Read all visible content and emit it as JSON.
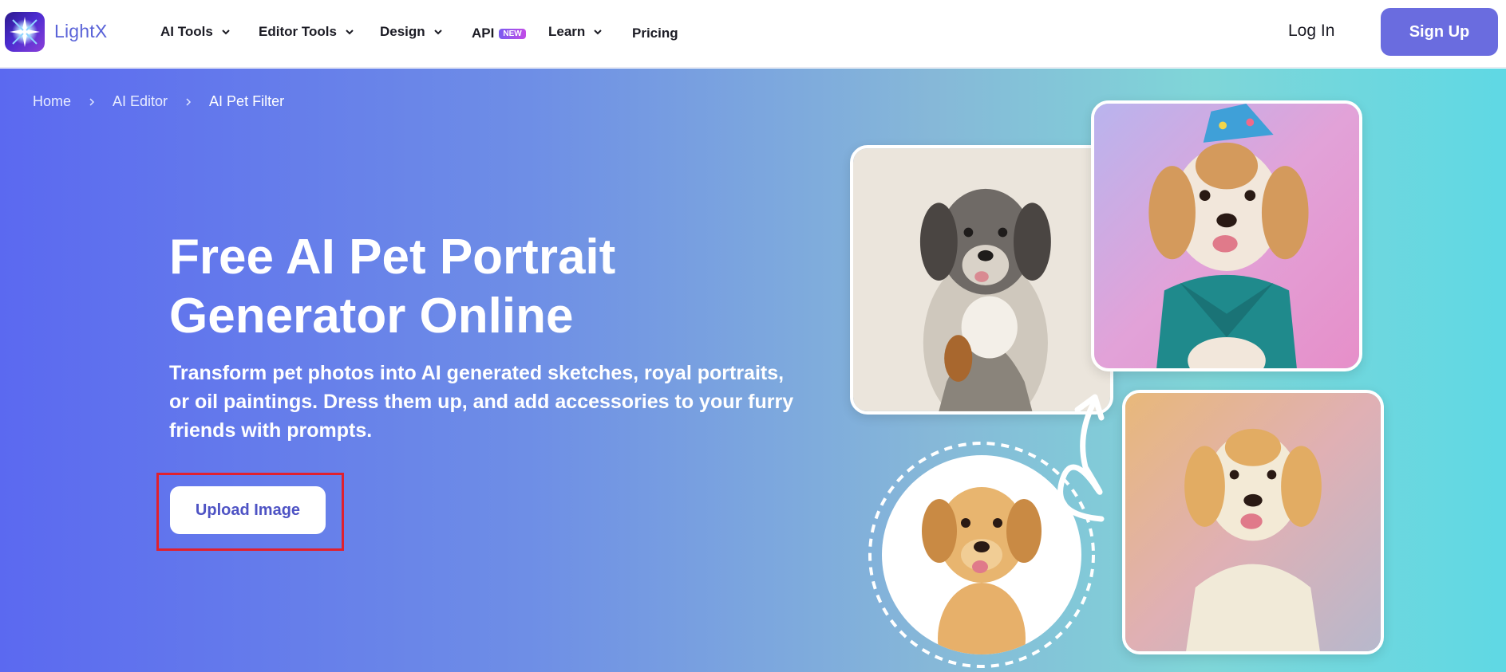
{
  "brand": {
    "name": "LightX",
    "logo_icon": "lightx-star-icon"
  },
  "nav": {
    "items": [
      {
        "label": "AI Tools",
        "has_dropdown": true
      },
      {
        "label": "Editor Tools",
        "has_dropdown": true
      },
      {
        "label": "Design",
        "has_dropdown": true
      },
      {
        "label": "API",
        "badge": "NEW",
        "has_dropdown": false
      },
      {
        "label": "Learn",
        "has_dropdown": true
      },
      {
        "label": "Pricing",
        "has_dropdown": false
      }
    ],
    "login_label": "Log In",
    "signup_label": "Sign Up"
  },
  "breadcrumb": [
    "Home",
    "AI Editor",
    "AI Pet Filter"
  ],
  "hero": {
    "title_line1": "Free AI Pet Portrait",
    "title_line2": "Generator Online",
    "subtitle": "Transform pet photos into AI generated sketches, royal portraits, or oil paintings. Dress them up, and add accessories to your furry friends with prompts.",
    "upload_label": "Upload Image"
  },
  "colors": {
    "accent": "#6a6cdf",
    "hero_gradient_start": "#5b69f0",
    "hero_gradient_end": "#5fd8e4",
    "highlight_box": "#e0202e"
  },
  "images": {
    "sketch_dog": "pencil-sketch-dog-image",
    "party_dog": "party-hat-dog-image",
    "source_dog": "golden-retriever-puppy-image",
    "painted_dog": "pastel-painting-dog-image",
    "arrow": "curved-arrow-icon"
  }
}
